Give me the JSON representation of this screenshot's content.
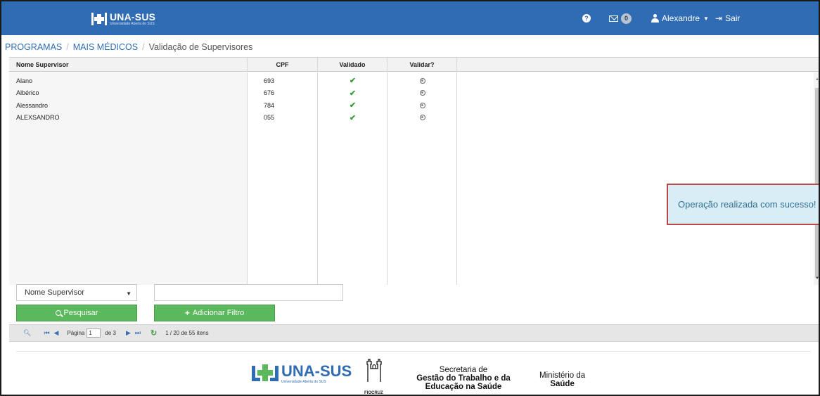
{
  "header": {
    "brand_name": "UNA-SUS",
    "brand_subtitle": "Universidade Aberta do SUS",
    "help_icon": "question-circle-icon",
    "mail_count": "0",
    "user_name": "Alexandre",
    "logout_label": "Sair",
    "bar_color": "#2f6cb3"
  },
  "breadcrumb": {
    "items": [
      "PROGRAMAS",
      "MAIS MÉDICOS",
      "Validação de Supervisores"
    ]
  },
  "grid": {
    "columns": [
      "Nome Supervisor",
      "CPF",
      "Validado",
      "Validar?"
    ],
    "rows": [
      {
        "name": "Alano",
        "cpf": "693",
        "validated": true
      },
      {
        "name": "Albérico",
        "cpf": "676",
        "validated": true
      },
      {
        "name": "Alessandro",
        "cpf": "784",
        "validated": true
      },
      {
        "name": "ALEXSANDRO",
        "cpf": "055",
        "validated": true
      }
    ]
  },
  "toast": {
    "message": "Operação realizada com sucesso!"
  },
  "filter": {
    "selected_field": "Nome Supervisor",
    "input_value": "",
    "search_label": "Pesquisar",
    "add_filter_label": "Adicionar Filtro"
  },
  "pager": {
    "page_label": "Página",
    "current_page": "1",
    "total_pages_label": "de 3",
    "summary": "1 / 20 de 55 itens"
  },
  "footer": {
    "unasus_name": "UNA-SUS",
    "unasus_subtitle": "Universidade Aberta do SUS",
    "fiocruz_label": "FIOCRUZ",
    "sec_line1": "Secretaria de",
    "sec_line2": "Gestão do Trabalho e da",
    "sec_line3": "Educação na Saúde",
    "min_line1": "Ministério da",
    "min_line2": "Saúde"
  }
}
